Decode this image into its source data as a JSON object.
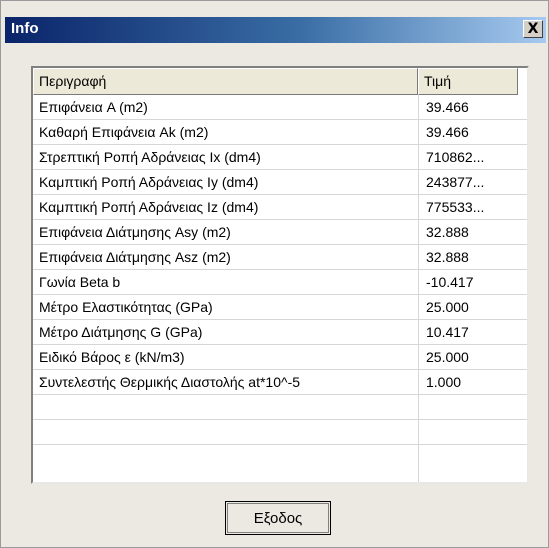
{
  "window": {
    "title": "Info",
    "close_label": "X"
  },
  "table": {
    "headers": [
      "Περιγραφή",
      "Τιμή"
    ],
    "rows": [
      {
        "desc": "Επιφάνεια  A (m2)",
        "value": "39.466"
      },
      {
        "desc": "Καθαρή Επιφάνεια    Ak (m2)",
        "value": "39.466"
      },
      {
        "desc": "Στρεπτική Ροπή Αδράνειας  Ix (dm4)",
        "value": "710862..."
      },
      {
        "desc": "Καμπτική Ροπή Αδράνειας Iy (dm4)",
        "value": "243877..."
      },
      {
        "desc": "Καμπτική Ροπή Αδράνειας Iz (dm4)",
        "value": "775533..."
      },
      {
        "desc": "Επιφάνεια Διάτμησης Asy (m2)",
        "value": "32.888"
      },
      {
        "desc": "Επιφάνεια Διάτμησης Asz (m2)",
        "value": "32.888"
      },
      {
        "desc": "Γωνία Beta  b",
        "value": "-10.417"
      },
      {
        "desc": "Μέτρο Ελαστικότητας (GPa)",
        "value": "25.000"
      },
      {
        "desc": "Μέτρο Διάτμησης  G (GPa)",
        "value": "10.417"
      },
      {
        "desc": "Ειδικό Βάρος   ε  (kN/m3)",
        "value": "25.000"
      },
      {
        "desc": "Συντελεστής Θερμικής Διαστολής at*10^-5",
        "value": "1.000"
      },
      {
        "desc": "",
        "value": ""
      },
      {
        "desc": "",
        "value": ""
      }
    ]
  },
  "buttons": {
    "exit_label": "Εξοδος"
  }
}
